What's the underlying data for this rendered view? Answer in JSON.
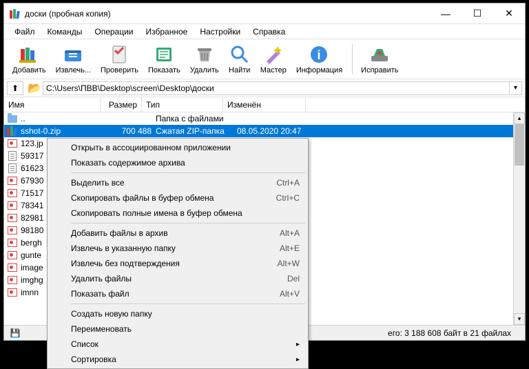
{
  "titlebar": {
    "title": "доски (пробная копия)"
  },
  "menubar": {
    "items": [
      "Файл",
      "Команды",
      "Операции",
      "Избранное",
      "Настройки",
      "Справка"
    ]
  },
  "toolbar": {
    "buttons": [
      {
        "icon": "add-icon",
        "label": "Добавить"
      },
      {
        "icon": "extract-icon",
        "label": "Извлечь..."
      },
      {
        "icon": "test-icon",
        "label": "Проверить"
      },
      {
        "icon": "view-icon",
        "label": "Показать"
      },
      {
        "icon": "delete-icon",
        "label": "Удалить"
      },
      {
        "icon": "find-icon",
        "label": "Найти"
      },
      {
        "icon": "wizard-icon",
        "label": "Мастер"
      },
      {
        "icon": "info-icon",
        "label": "Информация"
      },
      {
        "icon": "repair-icon",
        "label": "Исправить"
      }
    ]
  },
  "address": {
    "path": "C:\\Users\\ПВВ\\Desktop\\screen\\Desktop\\доски"
  },
  "columns": {
    "name": "Имя",
    "size": "Размер",
    "type": "Тип",
    "modified": "Изменён"
  },
  "rows": [
    {
      "icon": "folder",
      "name": "..",
      "size": "",
      "type": "Папка с файлами",
      "mod": "",
      "sel": false
    },
    {
      "icon": "zip",
      "name": "sshot-0.zip",
      "size": "700 488",
      "type": "Сжатая ZIP-папка",
      "mod": "08.05.2020 20:47",
      "sel": true
    },
    {
      "icon": "img",
      "name": "123.jp",
      "size": "",
      "type": "",
      "mod": "",
      "sel": false
    },
    {
      "icon": "txt",
      "name": "59317",
      "size": "",
      "type": "",
      "mod": "",
      "sel": false
    },
    {
      "icon": "txt",
      "name": "61623",
      "size": "",
      "type": "",
      "mod": "",
      "sel": false
    },
    {
      "icon": "img",
      "name": "67930",
      "size": "",
      "type": "",
      "mod": "",
      "sel": false
    },
    {
      "icon": "img",
      "name": "71517",
      "size": "",
      "type": "",
      "mod": "",
      "sel": false
    },
    {
      "icon": "img",
      "name": "78341",
      "size": "",
      "type": "",
      "mod": "",
      "sel": false
    },
    {
      "icon": "img",
      "name": "82981",
      "size": "",
      "type": "",
      "mod": "",
      "sel": false
    },
    {
      "icon": "img",
      "name": "98180",
      "size": "",
      "type": "",
      "mod": "",
      "sel": false
    },
    {
      "icon": "img",
      "name": "bergh",
      "size": "",
      "type": "",
      "mod": "",
      "sel": false
    },
    {
      "icon": "img",
      "name": "gunte",
      "size": "",
      "type": "",
      "mod": "",
      "sel": false
    },
    {
      "icon": "img",
      "name": "image",
      "size": "",
      "type": "",
      "mod": "",
      "sel": false
    },
    {
      "icon": "img",
      "name": "imghg",
      "size": "",
      "type": "",
      "mod": "",
      "sel": false
    },
    {
      "icon": "img",
      "name": "imnn",
      "size": "",
      "type": "",
      "mod": "",
      "sel": false
    }
  ],
  "context_menu": [
    {
      "type": "item",
      "label": "Открыть в ассоциированном приложении",
      "shortcut": ""
    },
    {
      "type": "item",
      "label": "Показать содержимое архива",
      "shortcut": ""
    },
    {
      "type": "sep"
    },
    {
      "type": "item",
      "label": "Выделить все",
      "shortcut": "Ctrl+A"
    },
    {
      "type": "item",
      "label": "Скопировать файлы в буфер обмена",
      "shortcut": "Ctrl+C"
    },
    {
      "type": "item",
      "label": "Скопировать полные имена в буфер обмена",
      "shortcut": ""
    },
    {
      "type": "sep"
    },
    {
      "type": "item",
      "label": "Добавить файлы в архив",
      "shortcut": "Alt+A"
    },
    {
      "type": "item",
      "label": "Извлечь в указанную папку",
      "shortcut": "Alt+E"
    },
    {
      "type": "item",
      "label": "Извлечь без подтверждения",
      "shortcut": "Alt+W"
    },
    {
      "type": "item",
      "label": "Удалить файлы",
      "shortcut": "Del"
    },
    {
      "type": "item",
      "label": "Показать файл",
      "shortcut": "Alt+V"
    },
    {
      "type": "sep"
    },
    {
      "type": "item",
      "label": "Создать новую папку",
      "shortcut": ""
    },
    {
      "type": "item",
      "label": "Переименовать",
      "shortcut": ""
    },
    {
      "type": "submenu",
      "label": "Список",
      "shortcut": ""
    },
    {
      "type": "submenu",
      "label": "Сортировка",
      "shortcut": ""
    }
  ],
  "statusbar": {
    "total": "его: 3 188 608 байт в 21 файлах"
  },
  "tool_svgs": {
    "add": "#e6c800",
    "extract": "#3a8de0",
    "test": "#d44",
    "view": "#3a7",
    "delete": "#888",
    "find": "#3a8de0",
    "wizard": "#b080e0",
    "info": "#3a8de0",
    "repair": "#3a7"
  }
}
